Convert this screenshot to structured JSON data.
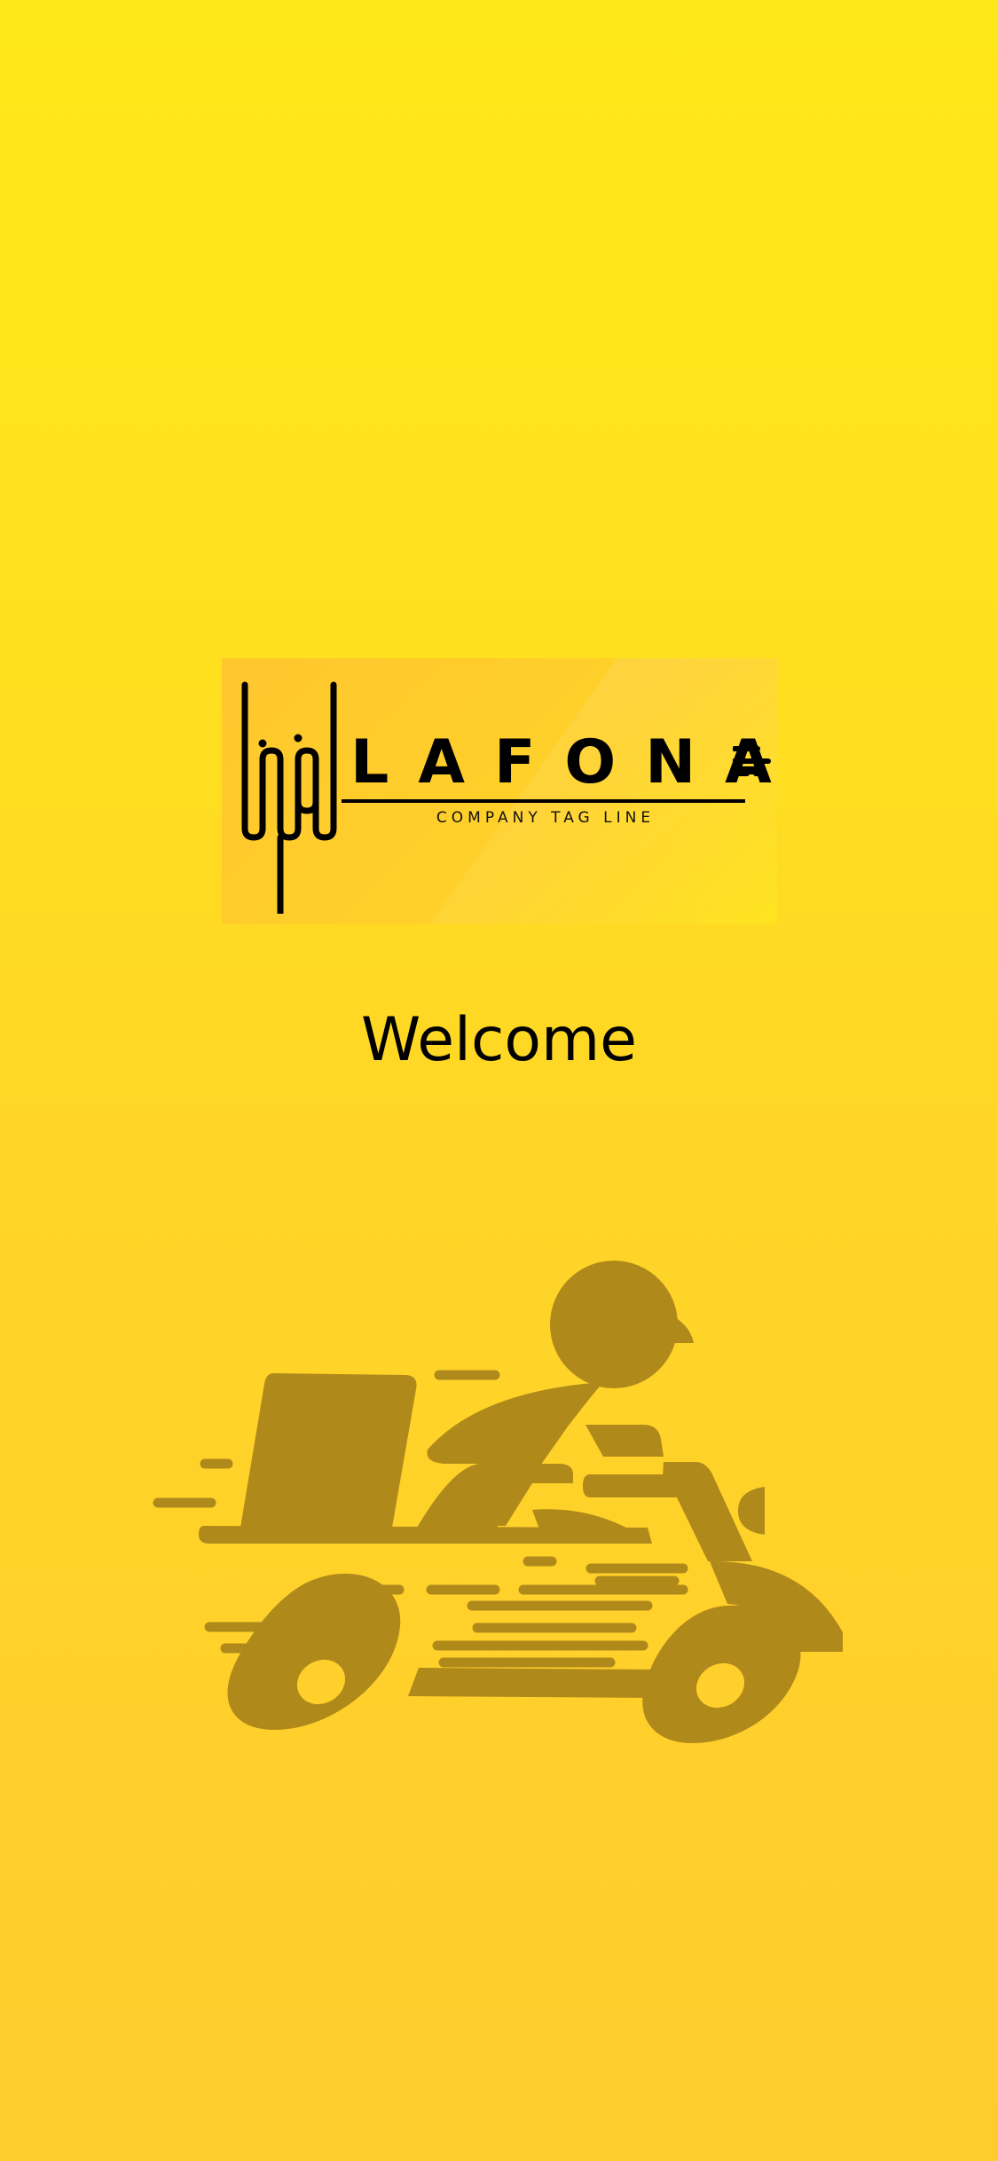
{
  "logo": {
    "brand_name": "LAFONA",
    "tagline": "COMPANY TAG LINE"
  },
  "welcome_text": "Welcome",
  "colors": {
    "background_top": "#FFE81A",
    "background_bottom": "#FFCC2E",
    "illustration": "#B0891B",
    "text": "#000000"
  },
  "icons": [
    "logo-monogram-icon",
    "speed-lines-icon",
    "delivery-scooter-icon"
  ]
}
